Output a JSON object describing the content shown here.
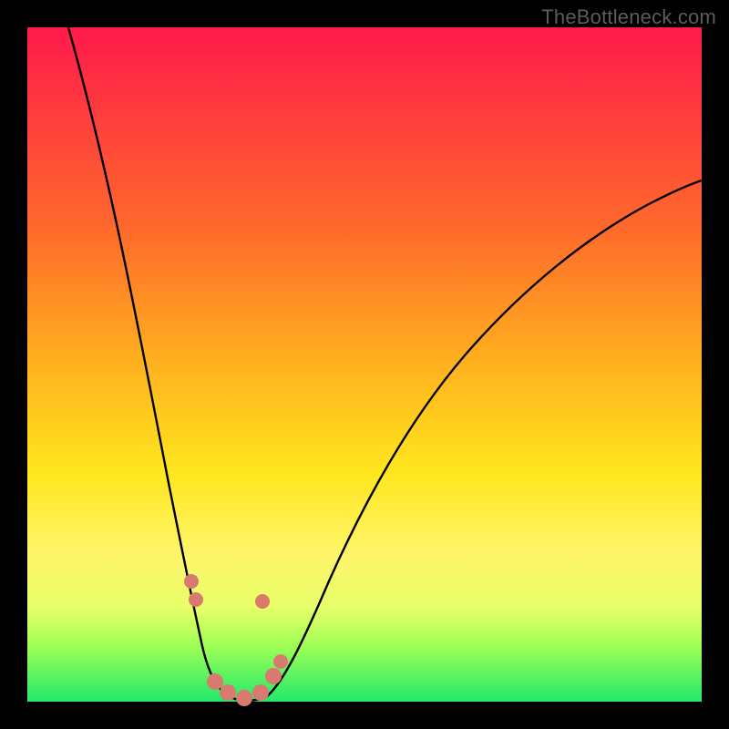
{
  "watermark": "TheBottleneck.com",
  "colors": {
    "frame": "#000000",
    "curve": "#000000",
    "dots": "#d87a70",
    "gradient_stops": [
      "#ff1a4b",
      "#ff3a3f",
      "#ff6a2b",
      "#ffb21e",
      "#ffe61e",
      "#fff56a",
      "#e8ff6a",
      "#9bff55",
      "#22e86b"
    ]
  },
  "chart_data": {
    "type": "line",
    "title": "",
    "xlabel": "",
    "ylabel": "",
    "xlim": [
      0,
      100
    ],
    "ylim": [
      0,
      100
    ],
    "grid": false,
    "legend": false,
    "note": "V-shaped bottleneck curve; y≈100 at edges, near 0 around x≈28–35",
    "series": [
      {
        "name": "bottleneck-curve",
        "x": [
          5,
          10,
          15,
          18,
          20,
          22,
          24,
          26,
          28,
          30,
          32,
          34,
          36,
          40,
          45,
          50,
          55,
          60,
          65,
          70,
          75,
          80,
          85,
          90,
          95,
          100
        ],
        "y": [
          100,
          85,
          68,
          55,
          45,
          33,
          20,
          10,
          4,
          1,
          0,
          0,
          3,
          10,
          20,
          30,
          38,
          46,
          52,
          58,
          63,
          67,
          71,
          74,
          77,
          80
        ]
      }
    ],
    "markers": [
      {
        "x": 23,
        "y": 18
      },
      {
        "x": 24,
        "y": 14
      },
      {
        "x": 27,
        "y": 3
      },
      {
        "x": 29,
        "y": 1
      },
      {
        "x": 32,
        "y": 0
      },
      {
        "x": 34,
        "y": 2
      },
      {
        "x": 36,
        "y": 5
      },
      {
        "x": 37,
        "y": 7
      },
      {
        "x": 34,
        "y": 15
      }
    ]
  }
}
